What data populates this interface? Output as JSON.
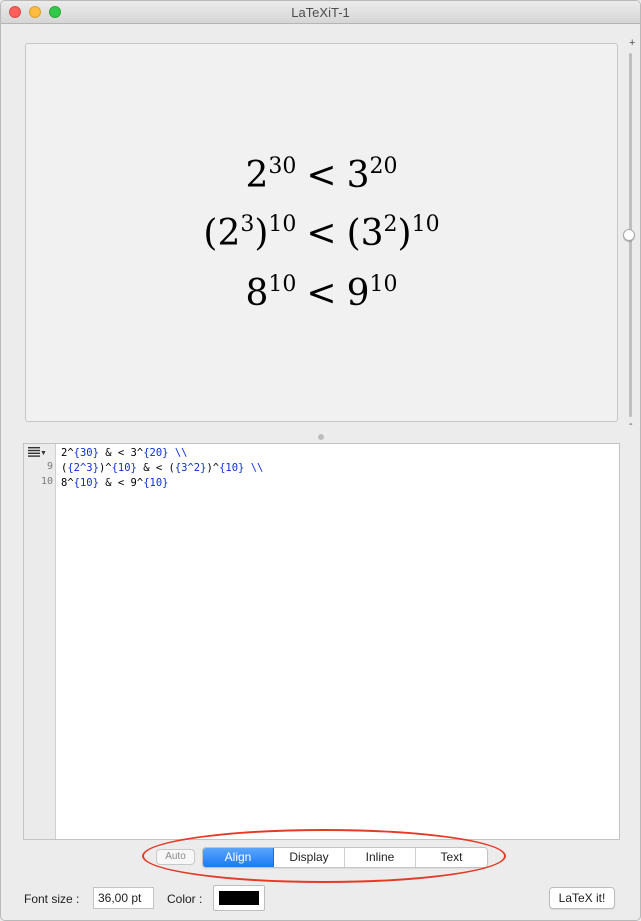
{
  "window": {
    "title": "LaTeXiT-1"
  },
  "preview": {
    "equations": [
      {
        "left_base": "2",
        "left_exp": "30",
        "relation": "<",
        "right_base": "3",
        "right_exp": "20"
      },
      {
        "left_base": "(2",
        "left_inner_exp": "3",
        "left_close": ")",
        "left_exp": "10",
        "relation": "<",
        "right_base": "(3",
        "right_inner_exp": "2",
        "right_close": ")",
        "right_exp": "10"
      },
      {
        "left_base": "8",
        "left_exp": "10",
        "relation": "<",
        "right_base": "9",
        "right_exp": "10"
      }
    ]
  },
  "zoom": {
    "plus": "+",
    "minus": "-"
  },
  "editor": {
    "menu_icon": "list-menu-icon",
    "line_numbers": [
      "9",
      "10"
    ],
    "lines": [
      {
        "a": "2^",
        "b": "{30}",
        "c": " & < 3^",
        "d": "{20}",
        "e": " \\\\"
      },
      {
        "a": "(",
        "b": "{2^3}",
        "c": ")^",
        "d": "{10}",
        "e": " & < (",
        "f": "{3^2}",
        "g": ")^",
        "h": "{10}",
        "i": " \\\\"
      },
      {
        "a": "8^",
        "b": "{10}",
        "c": " & < 9^",
        "d": "{10}"
      }
    ]
  },
  "modes": {
    "auto_label": "Auto",
    "options": [
      "Align",
      "Display",
      "Inline",
      "Text"
    ],
    "selected": "Align"
  },
  "bottom": {
    "font_size_label": "Font size :",
    "font_size_value": "36,00 pt",
    "color_label": "Color :",
    "color_value": "#000000",
    "latex_button": "LaTeX it!"
  },
  "colors": {
    "accent": "#1a79f5",
    "annotation": "#e53a24",
    "code_braces": "#0a2fd6"
  }
}
